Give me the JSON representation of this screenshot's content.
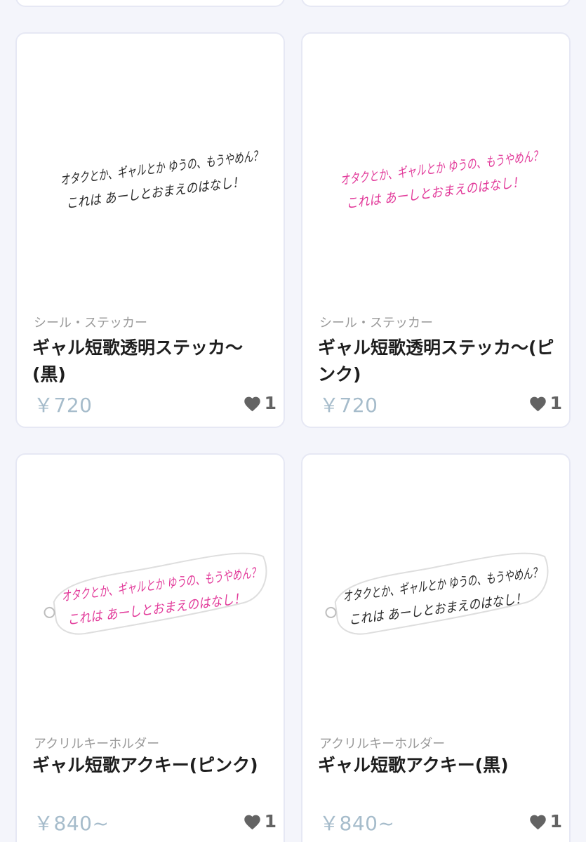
{
  "products": [
    {
      "category": "シール・ステッカー",
      "title": "ギャル短歌透明ステッカ〜(黒)",
      "price": "￥720",
      "favorites": "1",
      "image": {
        "line1": "オタクとか、ギャルとか ゆうの、もうやめん？",
        "line2": "これは あーしとおまえのはなし！",
        "ink_color": "#2b2b2b",
        "type": "sticker"
      }
    },
    {
      "category": "シール・ステッカー",
      "title": "ギャル短歌透明ステッカ〜(ピンク)",
      "price": "￥720",
      "favorites": "1",
      "image": {
        "line1": "オタクとか、ギャルとか ゆうの、もうやめん？",
        "line2": "これは あーしとおまえのはなし！",
        "ink_color": "#e23a9a",
        "type": "sticker"
      }
    },
    {
      "category": "アクリルキーホルダー",
      "title": "ギャル短歌アクキー(ピンク)",
      "price": "￥840~",
      "favorites": "1",
      "image": {
        "line1": "オタクとか、ギャルとか ゆうの、もうやめん？",
        "line2": "これは あーしとおまえのはなし！",
        "ink_color": "#e23a9a",
        "type": "keychain"
      }
    },
    {
      "category": "アクリルキーホルダー",
      "title": "ギャル短歌アクキー(黒)",
      "price": "￥840~",
      "favorites": "1",
      "image": {
        "line1": "オタクとか、ギャルとか ゆうの、もうやめん？",
        "line2": "これは あーしとおまえのはなし！",
        "ink_color": "#2b2b2b",
        "type": "keychain"
      }
    }
  ],
  "colors": {
    "background": "#f4f5fb",
    "card_border": "#e6e8f4",
    "price": "#a6bccb",
    "category": "#9a9a9a",
    "heart": "#636363"
  }
}
